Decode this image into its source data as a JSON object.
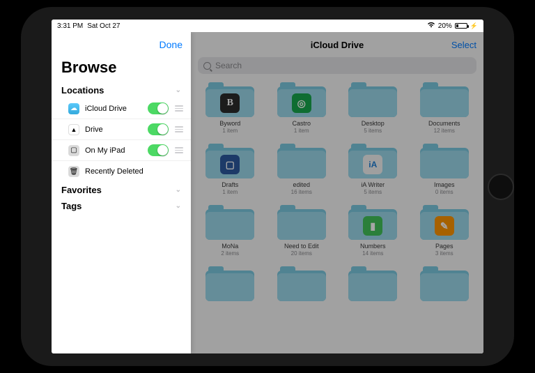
{
  "statusbar": {
    "time": "3:31 PM",
    "date": "Sat Oct 27",
    "battery_pct": "20%"
  },
  "sidebar": {
    "done_label": "Done",
    "title": "Browse",
    "sections": {
      "locations": "Locations",
      "favorites": "Favorites",
      "tags": "Tags"
    },
    "locations": [
      {
        "label": "iCloud Drive",
        "toggle": true,
        "color": "#3ec3ef"
      },
      {
        "label": "Drive",
        "toggle": true,
        "color": "#ffffff"
      },
      {
        "label": "On My iPad",
        "toggle": true,
        "color": "#d9d9d9"
      },
      {
        "label": "Recently Deleted",
        "toggle": null,
        "color": "#d9d9d9"
      }
    ]
  },
  "main": {
    "title": "iCloud Drive",
    "select_label": "Select",
    "search_placeholder": "Search",
    "folders": [
      {
        "name": "Byword",
        "sub": "1 item",
        "badge": "B",
        "bg": "#2b2b2b"
      },
      {
        "name": "Castro",
        "sub": "1 item",
        "badge": "◎",
        "bg": "#17a84d"
      },
      {
        "name": "Desktop",
        "sub": "5 items",
        "badge": "",
        "bg": ""
      },
      {
        "name": "Documents",
        "sub": "12 items",
        "badge": "",
        "bg": ""
      },
      {
        "name": "Drafts",
        "sub": "1 item",
        "badge": "▢",
        "bg": "#2d5aa0"
      },
      {
        "name": "edited",
        "sub": "16 items",
        "badge": "",
        "bg": ""
      },
      {
        "name": "iA Writer",
        "sub": "5 items",
        "badge": "iA",
        "bg": "#f4f4f4"
      },
      {
        "name": "Images",
        "sub": "0 items",
        "badge": "",
        "bg": ""
      },
      {
        "name": "MoNa",
        "sub": "2 items",
        "badge": "",
        "bg": ""
      },
      {
        "name": "Need to Edit",
        "sub": "20 items",
        "badge": "",
        "bg": ""
      },
      {
        "name": "Numbers",
        "sub": "14 items",
        "badge": "▮",
        "bg": "#43c35a"
      },
      {
        "name": "Pages",
        "sub": "3 items",
        "badge": "✎",
        "bg": "#ff9500"
      },
      {
        "name": "",
        "sub": "",
        "badge": "",
        "bg": ""
      },
      {
        "name": "",
        "sub": "",
        "badge": "",
        "bg": ""
      },
      {
        "name": "",
        "sub": "",
        "badge": "",
        "bg": ""
      },
      {
        "name": "",
        "sub": "",
        "badge": "",
        "bg": ""
      }
    ]
  }
}
